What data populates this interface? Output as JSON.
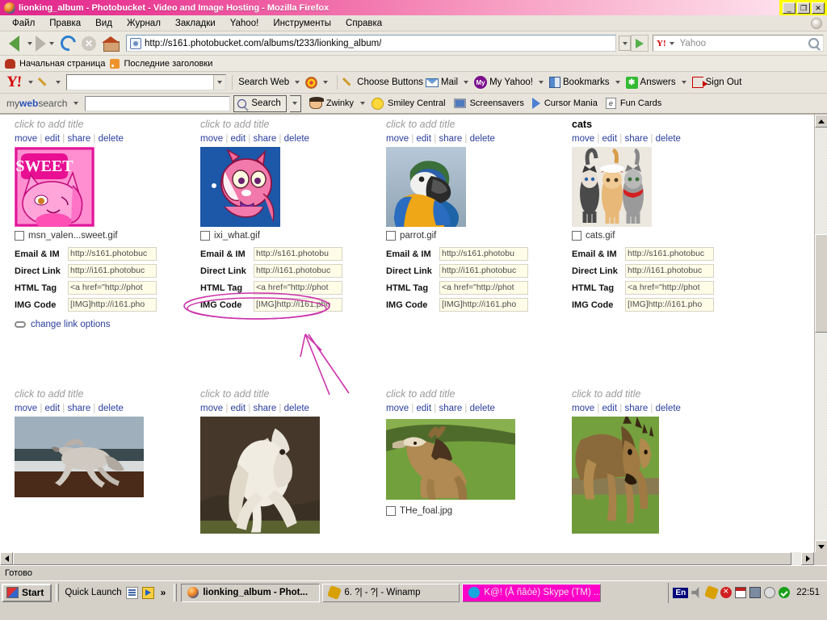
{
  "window": {
    "title": "lionking_album - Photobucket - Video and Image Hosting - Mozilla Firefox",
    "minimize": "_",
    "restore": "❐",
    "close": "✕"
  },
  "menubar": {
    "items": [
      "Файл",
      "Правка",
      "Вид",
      "Журнал",
      "Закладки",
      "Yahoo!",
      "Инструменты",
      "Справка"
    ]
  },
  "navbar": {
    "url": "http://s161.photobucket.com/albums/t233/lionking_album/",
    "yahoo_search_placeholder": "Yahoo"
  },
  "bookmarks": {
    "items": [
      {
        "label": "Начальная страница",
        "icon": "home-bookmark-icon"
      },
      {
        "label": "Последние заголовки",
        "icon": "rss-icon"
      }
    ]
  },
  "yahoo_toolbar": {
    "logo": "Y!",
    "search_value": "",
    "items": [
      {
        "label": "Search Web",
        "icon": "search-web-icon"
      },
      {
        "label": "Choose Buttons",
        "icon": "pencil-icon"
      },
      {
        "label": "Mail",
        "icon": "mail-icon"
      },
      {
        "label": "My Yahoo!",
        "icon": "my-yahoo-icon"
      },
      {
        "label": "Bookmarks",
        "icon": "bookmarks-icon"
      },
      {
        "label": "Answers",
        "icon": "answers-icon"
      },
      {
        "label": "Sign Out",
        "icon": "sign-out-icon"
      }
    ]
  },
  "mws_toolbar": {
    "logo_my": "my",
    "logo_web": "web",
    "logo_search": "search",
    "search_value": "",
    "search_button": "Search",
    "items": [
      {
        "label": "Zwinky",
        "icon": "zwinky-icon"
      },
      {
        "label": "Smiley Central",
        "icon": "smiley-icon"
      },
      {
        "label": "Screensavers",
        "icon": "screensaver-icon"
      },
      {
        "label": "Cursor Mania",
        "icon": "cursor-icon"
      },
      {
        "label": "Fun Cards",
        "icon": "fun-cards-icon"
      }
    ]
  },
  "album": {
    "action_links": [
      "move",
      "edit",
      "share",
      "delete"
    ],
    "code_labels": [
      "Email & IM",
      "Direct Link",
      "HTML Tag",
      "IMG Code"
    ],
    "change_link_options": "change link options",
    "items": [
      {
        "title": "click to add title",
        "titled": false,
        "filename": "msn_valen...sweet.gif",
        "codes": [
          "http://s161.photobuc",
          "http://i161.photobuc",
          "<a href=\"http://phot",
          "[IMG]http://i161.pho"
        ],
        "has_change_link": true,
        "thumb": "cat-sweet-pink-gif"
      },
      {
        "title": "click to add title",
        "titled": false,
        "filename": "ixi_what.gif",
        "codes": [
          "http://s161.photobu",
          "http://i161.photobuc",
          "<a href=\"http://phot",
          "[IMG]http://i161.pho"
        ],
        "has_change_link": false,
        "annotated": true,
        "thumb": "pink-creature-blue-gif"
      },
      {
        "title": "click to add title",
        "titled": false,
        "filename": "parrot.gif",
        "codes": [
          "http://s161.photobu",
          "http://i161.photobuc",
          "<a href=\"http://phot",
          "[IMG]http://i161.pho"
        ],
        "has_change_link": false,
        "thumb": "parrot-photo"
      },
      {
        "title": "cats",
        "titled": true,
        "filename": "cats.gif",
        "codes": [
          "http://s161.photobuc",
          "http://i161.photobuc",
          "<a href=\"http://phot",
          "[IMG]http://i161.pho"
        ],
        "has_change_link": false,
        "thumb": "three-cats-photo"
      },
      {
        "title": "click to add title",
        "titled": false,
        "filename": "",
        "codes": [],
        "thumb": "white-horse-beach-photo"
      },
      {
        "title": "click to add title",
        "titled": false,
        "filename": "",
        "codes": [],
        "thumb": "white-horse-rearing-photo"
      },
      {
        "title": "click to add title",
        "titled": false,
        "filename": "THe_foal.jpg",
        "codes": [],
        "thumb": "foal-grass-photo"
      },
      {
        "title": "click to add title",
        "titled": false,
        "filename": "",
        "codes": [],
        "thumb": "mare-and-foal-photo"
      }
    ]
  },
  "statusbar": {
    "text": "Готово"
  },
  "taskbar": {
    "start": "Start",
    "quick_launch": "Quick Launch",
    "chevron": "»",
    "buttons": [
      {
        "label": "lionking_album - Phot...",
        "state": "active",
        "icon": "firefox-icon"
      },
      {
        "label": "6. ?| - ?| - Winamp",
        "state": "plain",
        "icon": "winamp-icon"
      },
      {
        "label": "K@! (Å ñâòè) Skype (TM) ...",
        "state": "skype",
        "icon": "skype-icon"
      }
    ],
    "tray": {
      "language": "En",
      "icons": [
        "volume-icon",
        "winamp-tray-icon",
        "antivirus-alert-icon",
        "calendar-icon",
        "network-icon",
        "messenger-icon",
        "ok-shield-icon"
      ],
      "clock": "22:51"
    }
  },
  "colors": {
    "title_accent": "#e0258d",
    "annotation": "#cc33aa",
    "link": "#2a3d9e",
    "field_bg": "#fffde8"
  }
}
